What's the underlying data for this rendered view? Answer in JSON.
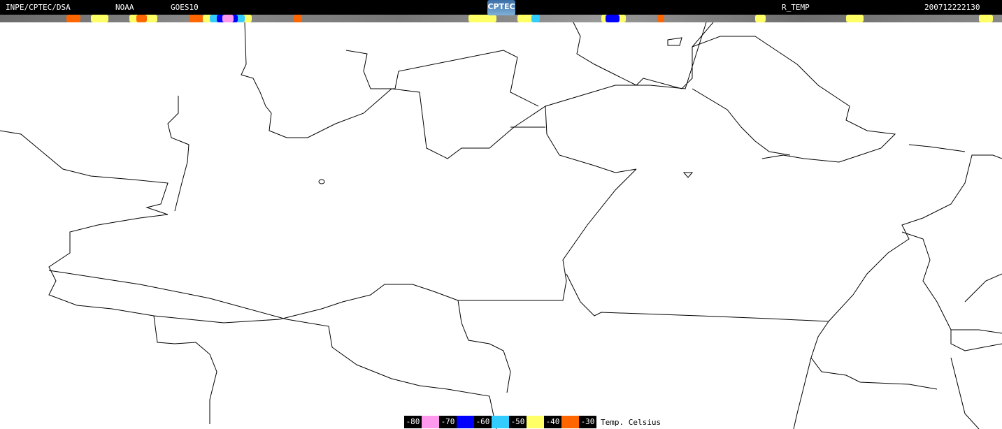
{
  "header": {
    "source": "INPE/CPTEC/DSA",
    "agency": "NOAA",
    "satellite": "GOES10",
    "logo": "CPTEC",
    "product": "R_TEMP",
    "datetime": "200712222130"
  },
  "legend": {
    "title": "Temp. Celsius",
    "items": [
      {
        "label": "-80",
        "color": "#ff99ee"
      },
      {
        "label": "-70",
        "color": "#0000ff"
      },
      {
        "label": "-60",
        "color": "#33ccff"
      },
      {
        "label": "-50",
        "color": "#ffff66"
      },
      {
        "label": "-40",
        "color": "#ff6600"
      },
      {
        "label": "-30",
        "color": null
      }
    ]
  }
}
